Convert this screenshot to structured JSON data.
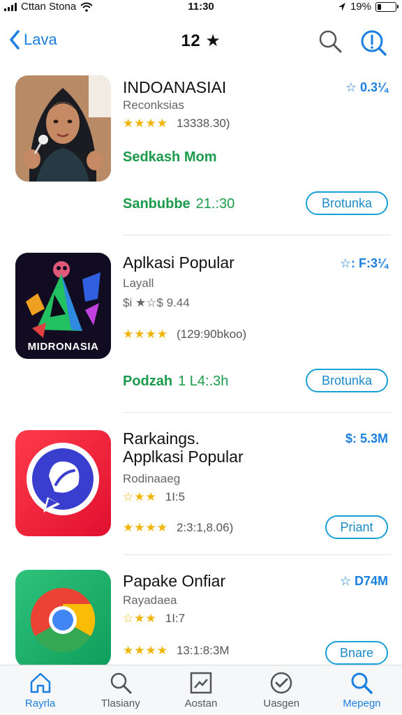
{
  "status_bar": {
    "carrier": "Cttan Stona",
    "time": "11:30",
    "battery": "19%",
    "battery_level": 0.19
  },
  "nav": {
    "back_label": "Lava",
    "title": "12 ★"
  },
  "apps": [
    {
      "name": "INDOANASIAI",
      "rank": "☆ 0.3¼",
      "subtitle": "Reconksias",
      "stars": "★★★★",
      "rating_count": "13338.30)",
      "promo": "Sedkash Mom",
      "price_label": "Sanbubbe",
      "price_value": "21.:30",
      "button_label": "Brotunka",
      "icon": "woman-portrait-icon"
    },
    {
      "name": "Aplkasi Popular",
      "rank": "☆: F:3¼",
      "subtitle": "Layall",
      "sub2": "$i ★☆$ 9.44",
      "stars": "★★★★",
      "rating_count": "(129:90bkoo)",
      "price_label": "Podzah",
      "price_value": "1 L4:.3h",
      "button_label": "Brotunka",
      "icon_text": "MIDRONASIA",
      "icon": "indonesia-logo-icon"
    },
    {
      "name_line1": "Rarkaings.",
      "name_line2": "Applkasi Popular",
      "rank": "$: 5.3M",
      "subtitle": "Rodinaaeg",
      "sub2_stars": "☆★★",
      "sub2": "1I:5",
      "stars": "★★★★",
      "rating_count": "2:3:1,8.06)",
      "button_label": "Priant",
      "icon": "chat-bubble-icon"
    },
    {
      "name": "Papake Onfiar",
      "rank": "☆ D74M",
      "subtitle": "Rayadaea",
      "sub2_stars": "☆★★",
      "sub2": "1I:7",
      "stars": "★★★★",
      "rating_count": "13:1:8:3M",
      "button_label": "Bnare",
      "icon": "chrome-icon"
    }
  ],
  "tabs": [
    {
      "label": "Rayrla",
      "icon": "home-icon",
      "active": true
    },
    {
      "label": "Tlasiany",
      "icon": "search-icon",
      "active": false
    },
    {
      "label": "Aostan",
      "icon": "image-icon",
      "active": false
    },
    {
      "label": "Uasgen",
      "icon": "check-icon",
      "active": false
    },
    {
      "label": "Mepegn",
      "icon": "search-icon",
      "active": true
    }
  ],
  "colors": {
    "accent": "#1a7fe0",
    "green": "#1a9a4a",
    "star": "#f0b400"
  }
}
